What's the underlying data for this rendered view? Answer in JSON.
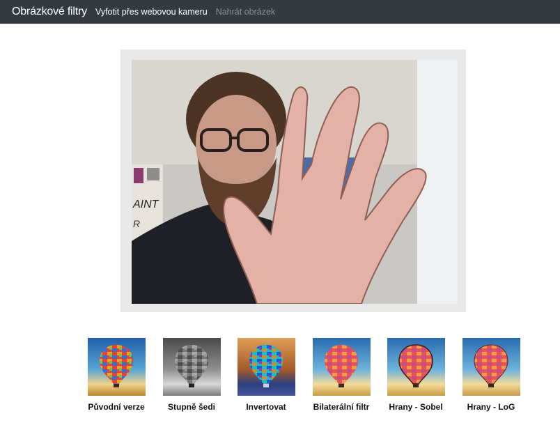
{
  "navbar": {
    "brand": "Obrázkové filtry",
    "links": [
      {
        "label": "Vyfotit přes webovou kameru",
        "state": "active"
      },
      {
        "label": "Nahrát obrázek",
        "state": "muted"
      }
    ]
  },
  "filters": [
    {
      "label": "Původní verze"
    },
    {
      "label": "Stupně šedi"
    },
    {
      "label": "Invertovat"
    },
    {
      "label": "Bilaterální filtr"
    },
    {
      "label": "Hrany - Sobel"
    },
    {
      "label": "Hrany - LoG"
    }
  ],
  "colors": {
    "navbar_bg": "#343a40",
    "frame_bg": "#e9e9e9"
  }
}
